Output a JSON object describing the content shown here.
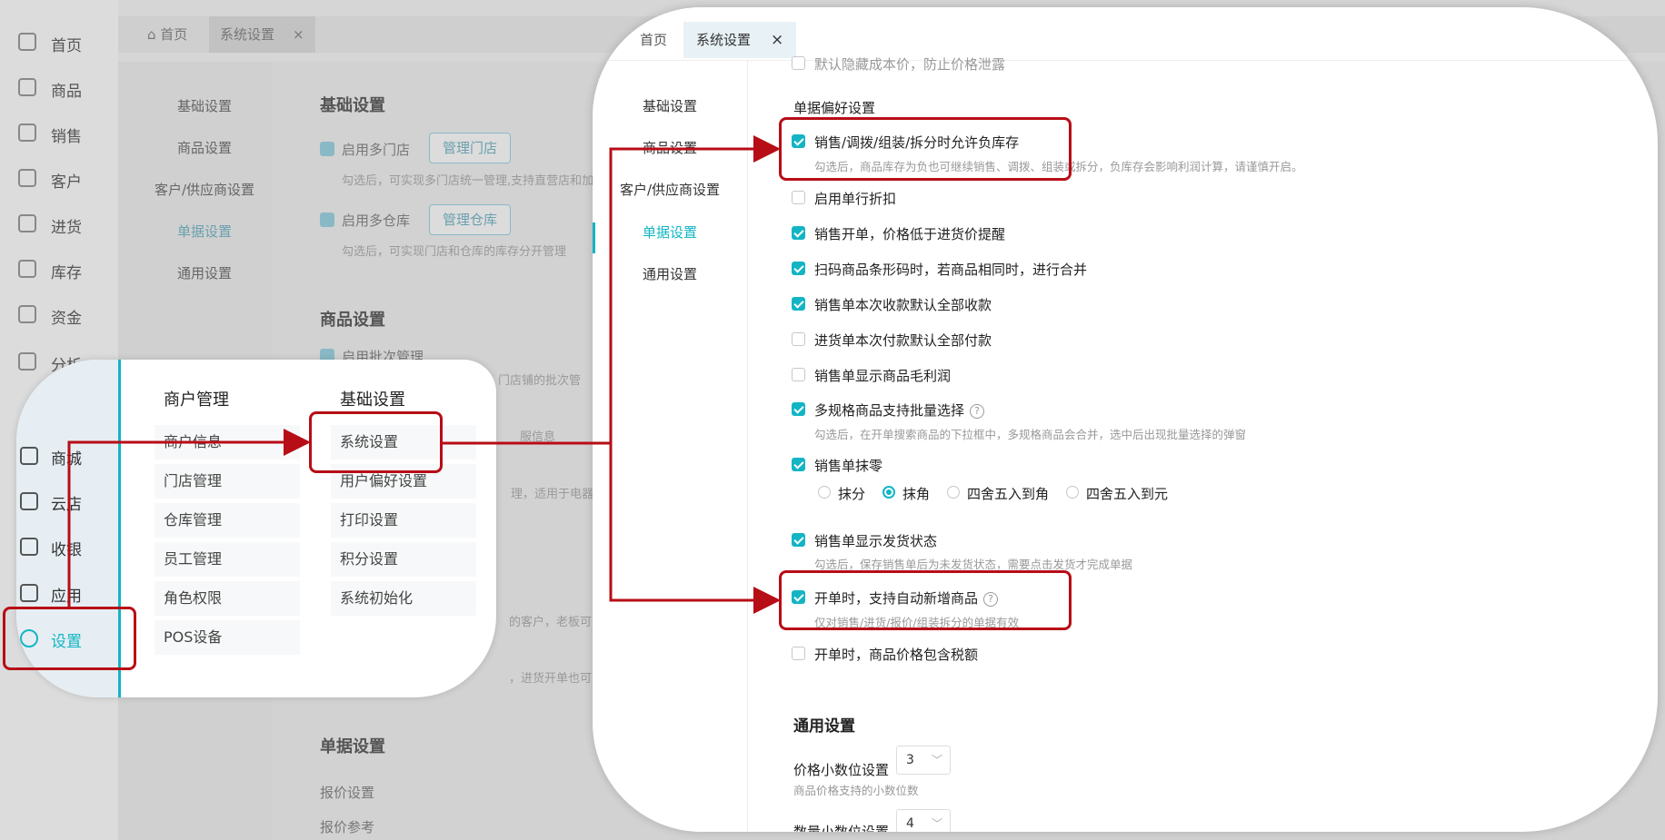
{
  "nav": [
    {
      "label": "首页",
      "icon": "home-icon"
    },
    {
      "label": "商品",
      "icon": "bag-icon"
    },
    {
      "label": "销售",
      "icon": "clipboard-icon"
    },
    {
      "label": "客户",
      "icon": "user-icon"
    },
    {
      "label": "进货",
      "icon": "book-icon"
    },
    {
      "label": "库存",
      "icon": "warehouse-icon"
    },
    {
      "label": "资金",
      "icon": "wallet-icon"
    },
    {
      "label": "分析",
      "icon": "chart-icon"
    }
  ],
  "tabs": {
    "home": "首页",
    "settings": "系统设置",
    "close": "×"
  },
  "bg_subnav": [
    "基础设置",
    "商品设置",
    "客户/供应商设置",
    "单据设置",
    "通用设置"
  ],
  "bg_main": {
    "section1": "基础设置",
    "multi_store": "启用多门店",
    "manage_store": "管理门店",
    "multi_store_hint": "勾选后，可实现多门店统一管理,支持直营店和加盟",
    "multi_wh": "启用多仓库",
    "manage_wh": "管理仓库",
    "multi_wh_hint": "勾选后，可实现门店和仓库的库存分开管理",
    "section2": "商品设置",
    "batch": "启用批次管理",
    "frag1": "门店铺的批次管",
    "frag2": "服信息",
    "frag3": "理，适用于电器",
    "frag4": "的客户，老板可",
    "frag5": "，进货开单也可以",
    "section3": "单据设置",
    "quote": "报价设置",
    "quote_ref": "报价参考"
  },
  "popup": {
    "nav": [
      {
        "label": "商城",
        "icon": "shop-icon"
      },
      {
        "label": "云店",
        "icon": "cloud-store-icon"
      },
      {
        "label": "收银",
        "icon": "cashier-icon"
      },
      {
        "label": "应用",
        "icon": "app-icon"
      },
      {
        "label": "设置",
        "icon": "gear-icon"
      }
    ],
    "col1_title": "商户管理",
    "col1": [
      "商户信息",
      "门店管理",
      "仓库管理",
      "员工管理",
      "角色权限",
      "POS设备"
    ],
    "col2_title": "基础设置",
    "col2": [
      "系统设置",
      "用户偏好设置",
      "打印设置",
      "积分设置",
      "系统初始化"
    ]
  },
  "zoom": {
    "tab_home": "首页",
    "tab_settings": "系统设置",
    "tab_close": "×",
    "subnav": [
      "基础设置",
      "商品设置",
      "客户/供应商设置",
      "单据设置",
      "通用设置"
    ],
    "top_partial": "默认隐藏成本价，防止价格泄露",
    "pref_title": "单据偏好设置",
    "options": [
      {
        "label": "销售/调拨/组装/拆分时允许负库存",
        "checked": true,
        "hint": "勾选后，商品库存为负也可继续销售、调拨、组装或拆分，负库存会影响利润计算，请谨慎开启。"
      },
      {
        "label": "启用单行折扣",
        "checked": false
      },
      {
        "label": "销售开单，价格低于进货价提醒",
        "checked": true
      },
      {
        "label": "扫码商品条形码时，若商品相同时，进行合并",
        "checked": true
      },
      {
        "label": "销售单本次收款默认全部收款",
        "checked": true
      },
      {
        "label": "进货单本次付款默认全部付款",
        "checked": false
      },
      {
        "label": "销售单显示商品毛利润",
        "checked": false
      },
      {
        "label": "多规格商品支持批量选择",
        "checked": true,
        "hint": "勾选后，在开单搜索商品的下拉框中，多规格商品会合并，选中后出现批量选择的弹窗"
      },
      {
        "label": "销售单抹零",
        "checked": true
      },
      {
        "label": "销售单显示发货状态",
        "checked": true,
        "hint": "勾选后，保存销售单后为未发货状态，需要点击发货才完成单据"
      },
      {
        "label": "开单时，支持自动新增商品",
        "checked": true,
        "hint": "仅对销售/进货/报价/组装拆分的单据有效"
      },
      {
        "label": "开单时，商品价格包含税额",
        "checked": false
      }
    ],
    "rounding": [
      {
        "label": "抹分",
        "selected": false
      },
      {
        "label": "抹角",
        "selected": true
      },
      {
        "label": "四舍五入到角",
        "selected": false
      },
      {
        "label": "四舍五入到元",
        "selected": false
      }
    ],
    "general_title": "通用设置",
    "price_decimals_label": "价格小数位设置",
    "price_decimals": "3",
    "price_decimals_hint": "商品价格支持的小数位数",
    "qty_decimals_label": "数量小数位设置",
    "qty_decimals": "4",
    "help": "?"
  },
  "colors": {
    "accent": "#13b5c4",
    "highlight": "#b70d16"
  }
}
